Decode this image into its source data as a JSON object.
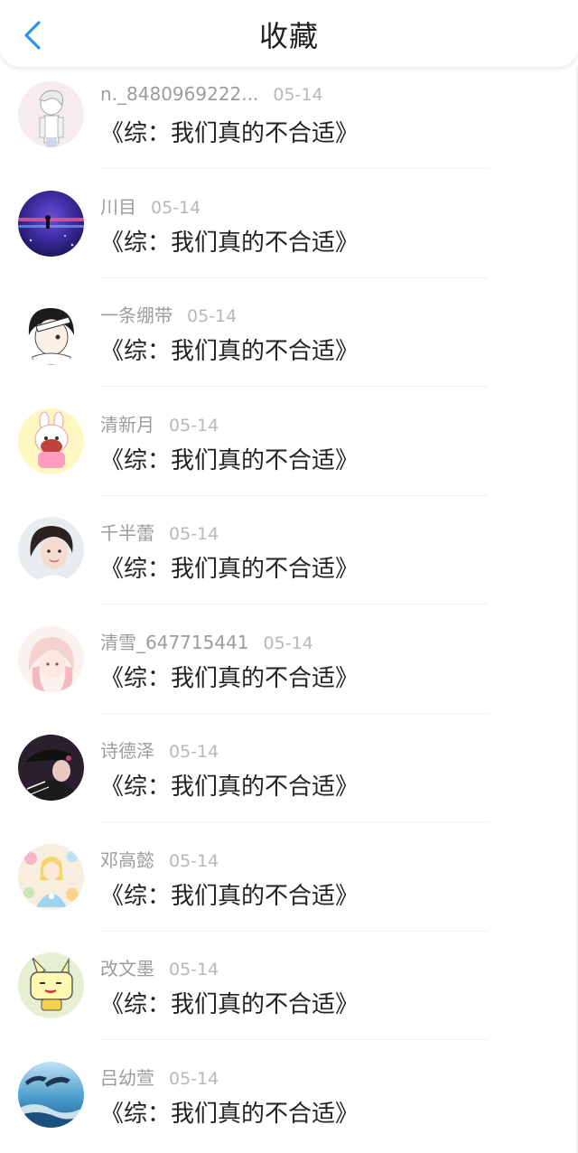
{
  "header": {
    "title": "收藏",
    "back_icon": "chevron-left-icon",
    "accent_color": "#2b93e8"
  },
  "list": {
    "items": [
      {
        "name": "n._8480969222...",
        "date": "05-14",
        "content": "《综：我们真的不合适》",
        "avatar": "anime-boy-white-hair"
      },
      {
        "name": "川目",
        "date": "05-14",
        "content": "《综：我们真的不合适》",
        "avatar": "purple-night-sky"
      },
      {
        "name": "一条绷带",
        "date": "05-14",
        "content": "《综：我们真的不合适》",
        "avatar": "anime-boy-bandage"
      },
      {
        "name": "清新月",
        "date": "05-14",
        "content": "《综：我们真的不合适》",
        "avatar": "cartoon-bunny-girl"
      },
      {
        "name": "千半蕾",
        "date": "05-14",
        "content": "《综：我们真的不合适》",
        "avatar": "girl-photo"
      },
      {
        "name": "清雪_647715441",
        "date": "05-14",
        "content": "《综：我们真的不合适》",
        "avatar": "pink-hair-girl"
      },
      {
        "name": "诗德泽",
        "date": "05-14",
        "content": "《综：我们真的不合适》",
        "avatar": "dark-figure"
      },
      {
        "name": "邓高懿",
        "date": "05-14",
        "content": "《综：我们真的不合适》",
        "avatar": "colorful-illustration"
      },
      {
        "name": "改文墨",
        "date": "05-14",
        "content": "《综：我们真的不合适》",
        "avatar": "cartoon-rabbit-yellow"
      },
      {
        "name": "吕幼萱",
        "date": "05-14",
        "content": "《综：我们真的不合适》",
        "avatar": "dolphins-ocean"
      }
    ]
  }
}
